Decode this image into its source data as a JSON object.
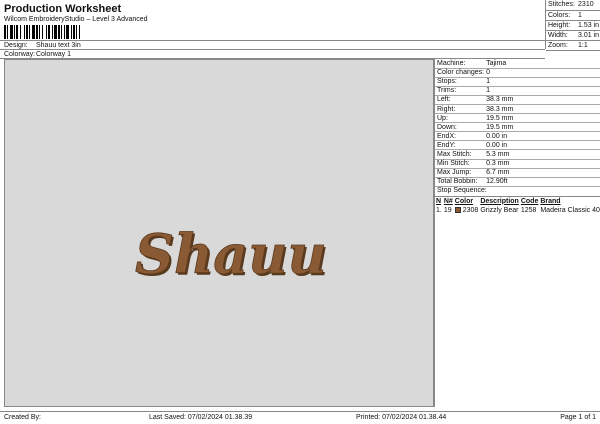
{
  "header": {
    "title": "Production Worksheet",
    "subtitle": "Wilcom EmbroideryStudio – Level 3 Advanced"
  },
  "design": {
    "label": "Design:",
    "value": "Shauu text 3in"
  },
  "colorway": {
    "label": "Colorway:",
    "value": "Colorway 1"
  },
  "stats": [
    {
      "key": "Stitches:",
      "value": "2310"
    },
    {
      "key": "Colors:",
      "value": "1"
    },
    {
      "key": "Height:",
      "value": "1.53 in"
    },
    {
      "key": "Width:",
      "value": "3.01 in"
    },
    {
      "key": "Zoom:",
      "value": "1:1"
    }
  ],
  "canvas": {
    "text": "Shauu",
    "fill_color": "#8a5a34",
    "outline_color": "#5a3a1e",
    "background": "#d9d9d9"
  },
  "machine_info": [
    {
      "key": "Machine:",
      "value": "Tajima"
    },
    {
      "key": "Color changes:",
      "value": "0"
    },
    {
      "key": "Stops:",
      "value": "1"
    },
    {
      "key": "Trims:",
      "value": "1"
    },
    {
      "key": "Left:",
      "value": "38.3 mm"
    },
    {
      "key": "Right:",
      "value": "38.3 mm"
    },
    {
      "key": "Up:",
      "value": "19.5 mm"
    },
    {
      "key": "Down:",
      "value": "19.5 mm"
    },
    {
      "key": "EndX:",
      "value": "0.00 in"
    },
    {
      "key": "EndY:",
      "value": "0.00 in"
    },
    {
      "key": "Max Stitch:",
      "value": "5.3 mm"
    },
    {
      "key": "Min Stitch:",
      "value": "0.3 mm"
    },
    {
      "key": "Max Jump:",
      "value": "6.7 mm"
    },
    {
      "key": "Total Bobbin:",
      "value": "12.90ft"
    }
  ],
  "stop_sequence": {
    "title": "Stop Sequence:",
    "headers": {
      "n": "N",
      "num": "N#",
      "color": "Color",
      "description": "Description",
      "code": "Code",
      "brand": "Brand"
    },
    "rows": [
      {
        "n": "1.",
        "num": "19",
        "color_hex": "#8a5a34",
        "color_id": "2308",
        "description": "Grizzly Bear",
        "code": "1258",
        "brand": "Madeira Classic 40"
      }
    ]
  },
  "footer": {
    "created_by": "Created By:",
    "last_saved": "Last Saved: 07/02/2024 01.38.39",
    "printed": "Printed: 07/02/2024 01.38.44",
    "page": "Page 1 of 1"
  }
}
